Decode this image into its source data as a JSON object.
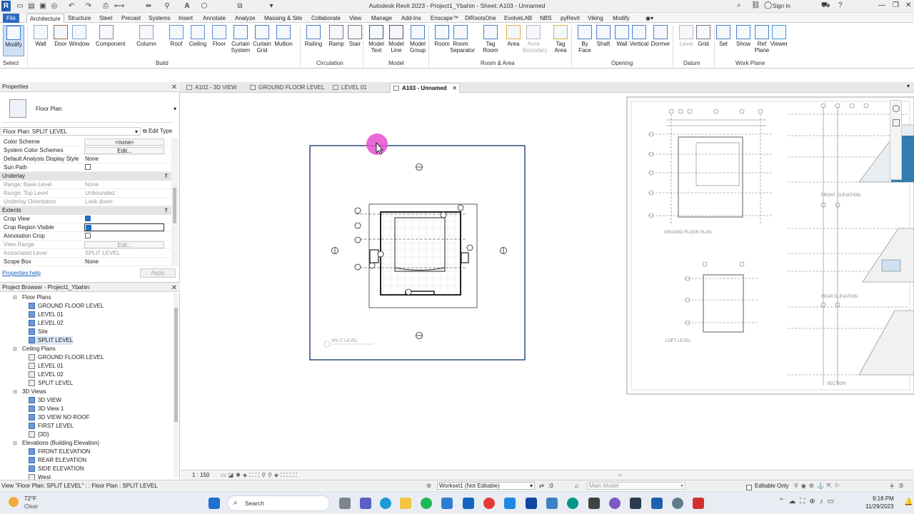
{
  "window": {
    "title": "Autodesk Revit 2023 - Project1_Ybahin - Sheet: A103 - Unnamed",
    "sign_in": "Sign In"
  },
  "ribbon_tabs": [
    "Architecture",
    "Structure",
    "Steel",
    "Precast",
    "Systems",
    "Insert",
    "Annotate",
    "Analyze",
    "Massing & Site",
    "Collaborate",
    "View",
    "Manage",
    "Add-Ins",
    "Enscape™",
    "DiRootsOne",
    "EvolveLAB",
    "NBS",
    "pyRevit",
    "Viking",
    "Modify"
  ],
  "file_tab": "File",
  "ribbon": {
    "buttons": [
      {
        "label": "Modify"
      },
      {
        "label": "Wall"
      },
      {
        "label": "Door"
      },
      {
        "label": "Window"
      },
      {
        "label": "Component"
      },
      {
        "label": "Column"
      },
      {
        "label": "Roof"
      },
      {
        "label": "Ceiling"
      },
      {
        "label": "Floor"
      },
      {
        "label": "Curtain\nSystem"
      },
      {
        "label": "Curtain\nGrid"
      },
      {
        "label": "Mullion"
      },
      {
        "label": "Railing"
      },
      {
        "label": "Ramp"
      },
      {
        "label": "Stair"
      },
      {
        "label": "Model\nText"
      },
      {
        "label": "Model\nLine"
      },
      {
        "label": "Model\nGroup"
      },
      {
        "label": "Room"
      },
      {
        "label": "Room\nSeparator"
      },
      {
        "label": "Tag\nRoom"
      },
      {
        "label": "Area"
      },
      {
        "label": "Area\nBoundary"
      },
      {
        "label": "Tag\nArea"
      },
      {
        "label": "By\nFace"
      },
      {
        "label": "Shaft"
      },
      {
        "label": "Wall"
      },
      {
        "label": "Vertical"
      },
      {
        "label": "Dormer"
      },
      {
        "label": "Level"
      },
      {
        "label": "Grid"
      },
      {
        "label": "Set"
      },
      {
        "label": "Show"
      },
      {
        "label": "Ref\nPlane"
      },
      {
        "label": "Viewer"
      }
    ],
    "groups": [
      "Select",
      "Build",
      "Circulation",
      "Model",
      "Room & Area",
      "Opening",
      "Datum",
      "Work Plane"
    ]
  },
  "properties": {
    "title": "Properties",
    "type_name": "Floor Plan",
    "instance_selector": "Floor Plan: SPLIT LEVEL",
    "edit_type": "Edit Type",
    "rows1": [
      {
        "k": "Color Scheme",
        "v": "<none>"
      },
      {
        "k": "System Color Schemes",
        "v": "Edit..."
      },
      {
        "k": "Default Analysis Display Style",
        "v": "None"
      },
      {
        "k": "Sun Path",
        "v": ""
      }
    ],
    "section_underlay": "Underlay",
    "rows2": [
      {
        "k": "Range: Base Level",
        "v": "None"
      },
      {
        "k": "Range: Top Level",
        "v": "Unbounded"
      },
      {
        "k": "Underlay Orientation",
        "v": "Look down"
      }
    ],
    "section_extents": "Extents",
    "rows3": [
      {
        "k": "Crop View",
        "v": ""
      },
      {
        "k": "Crop Region Visible",
        "v": ""
      },
      {
        "k": "Annotation Crop",
        "v": ""
      },
      {
        "k": "View Range",
        "v": "Edit..."
      },
      {
        "k": "Associated Level",
        "v": "SPLIT LEVEL"
      },
      {
        "k": "Scope Box",
        "v": "None"
      }
    ],
    "help_link": "Properties help",
    "apply": "Apply"
  },
  "browser": {
    "title": "Project Browser - Project1_Ybahin",
    "items": [
      {
        "t": "Floor Plans",
        "lvl": 1,
        "kind": "group"
      },
      {
        "t": "GROUND FLOOR LEVEL",
        "lvl": 2,
        "kind": "fp"
      },
      {
        "t": "LEVEL 01",
        "lvl": 2,
        "kind": "fp"
      },
      {
        "t": "LEVEL 02",
        "lvl": 2,
        "kind": "fp"
      },
      {
        "t": "Site",
        "lvl": 2,
        "kind": "fp"
      },
      {
        "t": "SPLIT LEVEL",
        "lvl": 2,
        "kind": "fp",
        "selected": true
      },
      {
        "t": "Ceiling Plans",
        "lvl": 1,
        "kind": "group"
      },
      {
        "t": "GROUND FLOOR LEVEL",
        "lvl": 2,
        "kind": "cp"
      },
      {
        "t": "LEVEL 01",
        "lvl": 2,
        "kind": "cp"
      },
      {
        "t": "LEVEL 02",
        "lvl": 2,
        "kind": "cp"
      },
      {
        "t": "SPLIT LEVEL",
        "lvl": 2,
        "kind": "cp"
      },
      {
        "t": "3D Views",
        "lvl": 1,
        "kind": "group"
      },
      {
        "t": "3D VIEW",
        "lvl": 2,
        "kind": "fp"
      },
      {
        "t": "3D View 1",
        "lvl": 2,
        "kind": "fp"
      },
      {
        "t": "3D VIEW NO ROOF",
        "lvl": 2,
        "kind": "fp"
      },
      {
        "t": "FIRST LEVEL",
        "lvl": 2,
        "kind": "fp"
      },
      {
        "t": "{3D}",
        "lvl": 2,
        "kind": "cp"
      },
      {
        "t": "Elevations (Building Elevation)",
        "lvl": 1,
        "kind": "group"
      },
      {
        "t": "FRONT ELEVATION",
        "lvl": 2,
        "kind": "fp"
      },
      {
        "t": "REAR ELEVATION",
        "lvl": 2,
        "kind": "fp"
      },
      {
        "t": "SIDE ELEVATION",
        "lvl": 2,
        "kind": "fp"
      },
      {
        "t": "West",
        "lvl": 2,
        "kind": "cp"
      }
    ]
  },
  "view_tabs": [
    {
      "label": "A102 - 3D VIEW",
      "active": false
    },
    {
      "label": "GROUND FLOOR LEVEL",
      "active": false
    },
    {
      "label": "LEVEL 01",
      "active": false
    },
    {
      "label": "A103 - Unnamed",
      "active": true
    }
  ],
  "drawing": {
    "view_label": "SPLIT LEVEL",
    "sheet_labels": [
      "FRONT ELEVATION",
      "GROUND FLOOR PLAN",
      "REAR ELEVATION",
      "LOFT LEVEL",
      "SECTION"
    ]
  },
  "view_control": {
    "scale": "1 : 150"
  },
  "status": {
    "message": "View \"Floor Plan: SPLIT LEVEL\" : : Floor Plan : SPLIT LEVEL",
    "workset": "Workset1 (Not Editable)",
    "count": ":0",
    "model": "Main Model",
    "editable_only": "Editable Only",
    "filter_count": ":0"
  },
  "taskbar": {
    "weather_temp": "72°F",
    "weather_desc": "Clear",
    "search": "Search",
    "time": "9:18 PM",
    "date": "11/29/2023"
  },
  "colors": {
    "accent": "#2b6bc0",
    "cursor_highlight": "#e84fd0",
    "selected_row": "#dbe7f6"
  }
}
